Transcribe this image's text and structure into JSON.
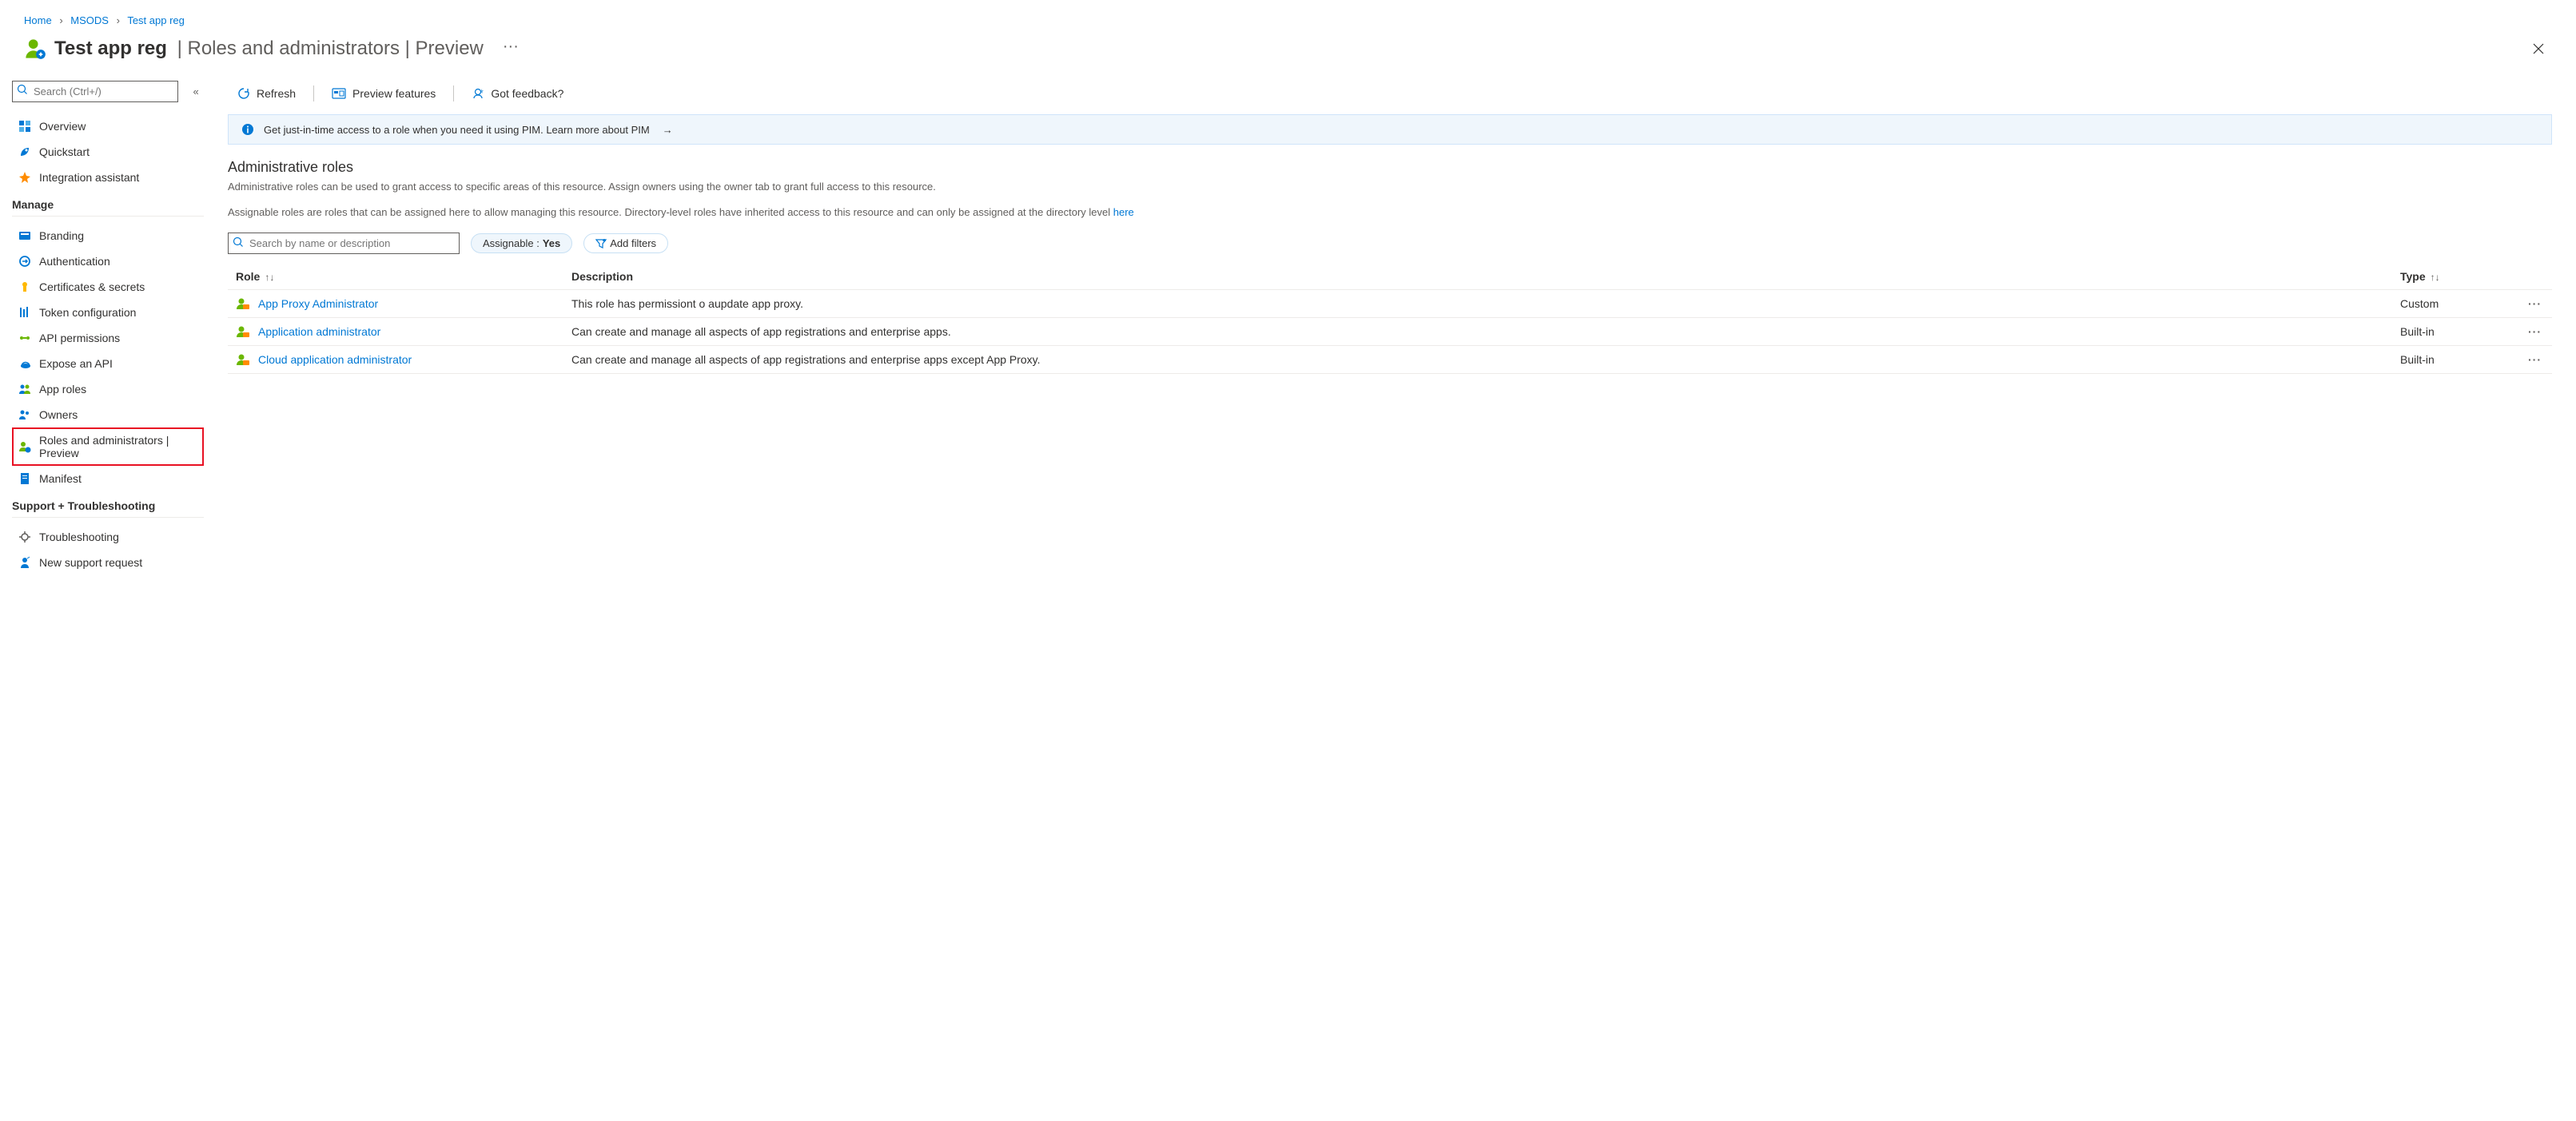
{
  "breadcrumb": {
    "items": [
      "Home",
      "MSODS",
      "Test app reg"
    ]
  },
  "title": {
    "app_name": "Test app reg",
    "subtitle": "Roles and administrators | Preview"
  },
  "sidebar": {
    "search_placeholder": "Search (Ctrl+/)",
    "top": [
      {
        "label": "Overview",
        "icon": "overview"
      },
      {
        "label": "Quickstart",
        "icon": "quickstart"
      },
      {
        "label": "Integration assistant",
        "icon": "integration"
      }
    ],
    "manage_header": "Manage",
    "manage": [
      {
        "label": "Branding",
        "icon": "branding"
      },
      {
        "label": "Authentication",
        "icon": "auth"
      },
      {
        "label": "Certificates & secrets",
        "icon": "cert"
      },
      {
        "label": "Token configuration",
        "icon": "token"
      },
      {
        "label": "API permissions",
        "icon": "api"
      },
      {
        "label": "Expose an API",
        "icon": "expose"
      },
      {
        "label": "App roles",
        "icon": "approles"
      },
      {
        "label": "Owners",
        "icon": "owners"
      },
      {
        "label": "Roles and administrators | Preview",
        "icon": "roles",
        "selected": true
      },
      {
        "label": "Manifest",
        "icon": "manifest"
      }
    ],
    "support_header": "Support + Troubleshooting",
    "support": [
      {
        "label": "Troubleshooting",
        "icon": "troubleshoot"
      },
      {
        "label": "New support request",
        "icon": "support"
      }
    ]
  },
  "cmdbar": {
    "refresh": "Refresh",
    "preview_features": "Preview features",
    "got_feedback": "Got feedback?"
  },
  "banner": {
    "text": "Get just-in-time access to a role when you need it using PIM. Learn more about PIM"
  },
  "section": {
    "title": "Administrative roles",
    "desc1": "Administrative roles can be used to grant access to specific areas of this resource. Assign owners using the owner tab to grant full access to this resource.",
    "desc2_prefix": "Assignable roles are roles that can be assigned here to allow managing this resource. Directory-level roles have inherited access to this resource and can only be assigned at the directory level ",
    "desc2_link": "here"
  },
  "filter": {
    "search_placeholder": "Search by name or description",
    "assignable_label": "Assignable : ",
    "assignable_value": "Yes",
    "add_filters": "Add filters"
  },
  "table": {
    "col_role": "Role",
    "col_description": "Description",
    "col_type": "Type",
    "rows": [
      {
        "role": "App Proxy Administrator",
        "description": "This role has permissiont o aupdate app proxy.",
        "type": "Custom"
      },
      {
        "role": "Application administrator",
        "description": "Can create and manage all aspects of app registrations and enterprise apps.",
        "type": "Built-in"
      },
      {
        "role": "Cloud application administrator",
        "description": "Can create and manage all aspects of app registrations and enterprise apps except App Proxy.",
        "type": "Built-in"
      }
    ]
  }
}
